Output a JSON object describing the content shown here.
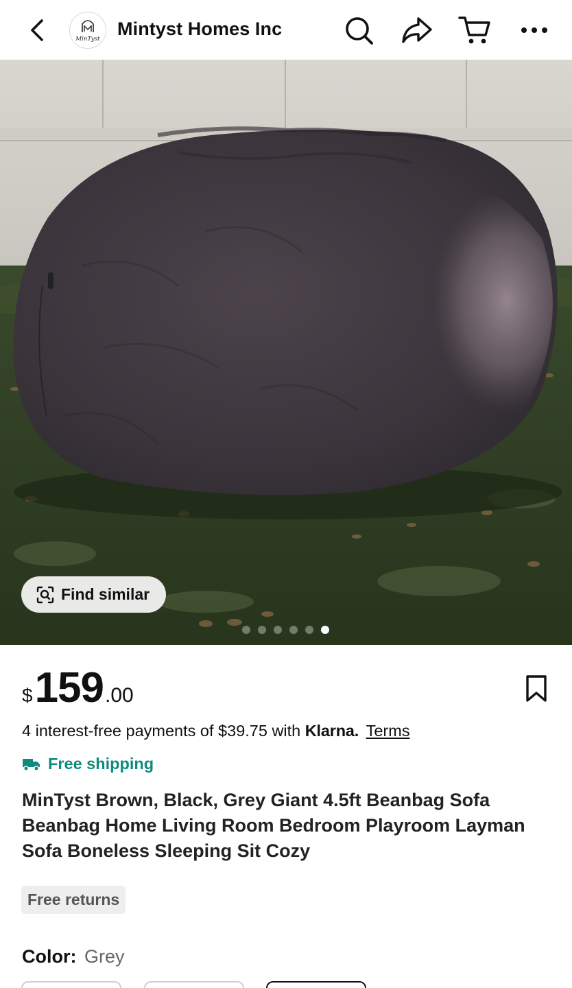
{
  "header": {
    "store_name": "Mintyst Homes Inc",
    "logo_text": "MinTyst",
    "icons": [
      "back-arrow-icon",
      "search-icon",
      "share-icon",
      "cart-icon",
      "more-icon"
    ]
  },
  "gallery": {
    "find_similar_label": "Find similar",
    "image_count": 6,
    "active_index": 5
  },
  "product": {
    "currency": "$",
    "price_main": "159",
    "price_cents": ".00",
    "klarna_text": "4 interest-free payments of $39.75 with",
    "klarna_brand": "Klarna.",
    "terms_label": "Terms",
    "shipping_label": "Free shipping",
    "title": "MinTyst Brown, Black, Grey Giant 4.5ft Beanbag Sofa Beanbag Home Living Room Bedroom Playroom Layman Sofa Boneless Sleeping Sit Cozy",
    "returns_label": "Free returns",
    "color_key": "Color:",
    "color_value": "Grey"
  },
  "colors": {
    "shipping_accent": "#0f8a7e",
    "text_primary": "#111111"
  }
}
